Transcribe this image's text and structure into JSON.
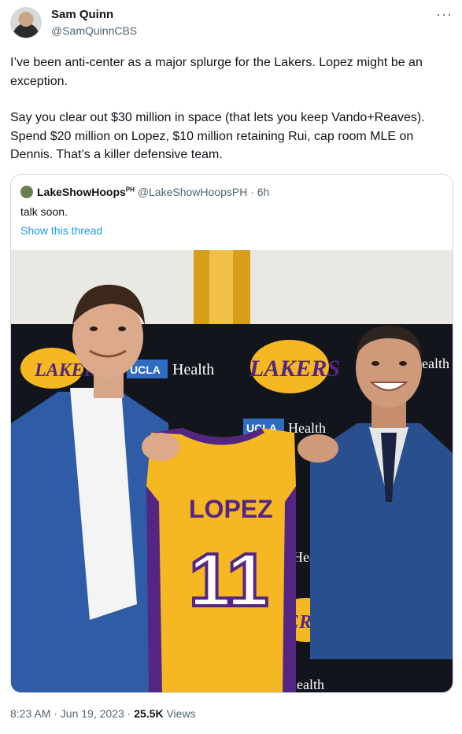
{
  "author": {
    "name": "Sam Quinn",
    "handle": "@SamQuinnCBS",
    "more": "···"
  },
  "tweet": {
    "p1": "I’ve been anti-center as a major splurge for the Lakers. Lopez might be an exception.",
    "p2": "Say you clear out $30 million in space (that lets you keep Vando+Reaves). Spend $20 million on Lopez, $10 million retaining Rui, cap room MLE on Dennis. That’s a killer defensive team."
  },
  "quote": {
    "name": "LakeShowHoops",
    "name_sup": "PH",
    "handle": "@LakeShowHoopsPH",
    "time": "· 6h",
    "text": "talk soon.",
    "thread_link": "Show this thread"
  },
  "photo": {
    "banner_left_logo": "LAKERS",
    "banner_sponsor": "Health",
    "banner_sponsor_prefix": "UCLA",
    "banner_center_logo": "LAKERS",
    "banner_right_text": "ealth",
    "jersey_name": "LOPEZ",
    "jersey_number": "11"
  },
  "footer": {
    "time": "8:23 AM · Jun 19, 2023 · ",
    "views_count": "25.5K",
    "views_label": " Views"
  },
  "colors": {
    "link": "#1d9bf0",
    "lakers_gold": "#f5b823",
    "lakers_purple": "#552583",
    "backdrop": "#13151c"
  }
}
